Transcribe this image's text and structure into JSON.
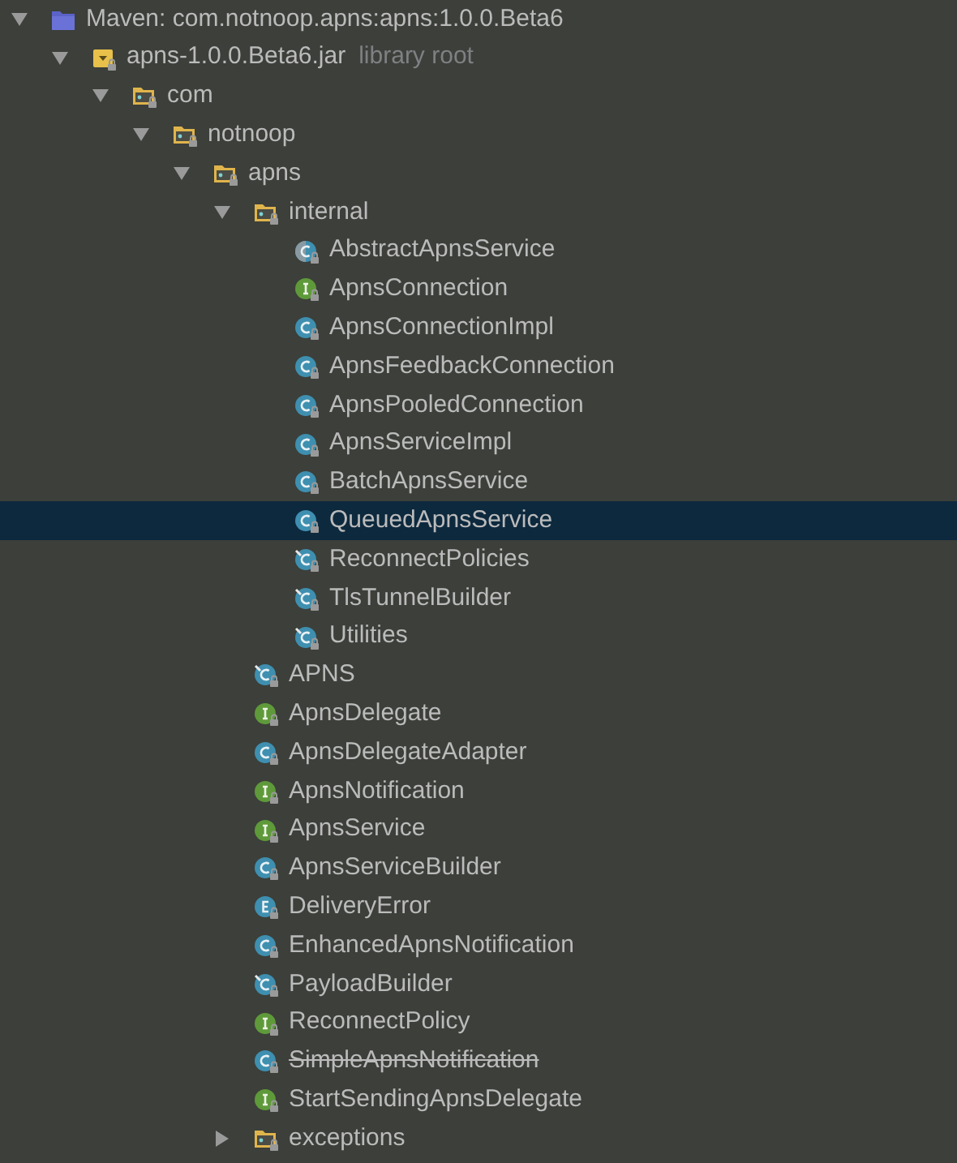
{
  "tree": [
    {
      "kind": "library",
      "label": "Maven: com.notnoop.apns:apns:1.0.0.Beta6",
      "expanded": true,
      "children": [
        {
          "kind": "jar",
          "label": "apns-1.0.0.Beta6.jar",
          "note": "library root",
          "expanded": true,
          "children": [
            {
              "kind": "package",
              "label": "com",
              "expanded": true,
              "children": [
                {
                  "kind": "package",
                  "label": "notnoop",
                  "expanded": true,
                  "children": [
                    {
                      "kind": "package",
                      "label": "apns",
                      "expanded": true,
                      "children": [
                        {
                          "kind": "package",
                          "label": "internal",
                          "expanded": true,
                          "children": [
                            {
                              "kind": "abstract",
                              "label": "AbstractApnsService",
                              "selected": false
                            },
                            {
                              "kind": "interface",
                              "label": "ApnsConnection",
                              "selected": false
                            },
                            {
                              "kind": "class",
                              "label": "ApnsConnectionImpl",
                              "selected": false
                            },
                            {
                              "kind": "class",
                              "label": "ApnsFeedbackConnection",
                              "selected": false
                            },
                            {
                              "kind": "class",
                              "label": "ApnsPooledConnection",
                              "selected": false
                            },
                            {
                              "kind": "class",
                              "label": "ApnsServiceImpl",
                              "selected": false
                            },
                            {
                              "kind": "class",
                              "label": "BatchApnsService",
                              "selected": false
                            },
                            {
                              "kind": "class",
                              "label": "QueuedApnsService",
                              "selected": true
                            },
                            {
                              "kind": "final",
                              "label": "ReconnectPolicies",
                              "selected": false
                            },
                            {
                              "kind": "final",
                              "label": "TlsTunnelBuilder",
                              "selected": false
                            },
                            {
                              "kind": "final",
                              "label": "Utilities",
                              "selected": false
                            }
                          ]
                        },
                        {
                          "kind": "final",
                          "label": "APNS",
                          "selected": false
                        },
                        {
                          "kind": "interface",
                          "label": "ApnsDelegate",
                          "selected": false
                        },
                        {
                          "kind": "class",
                          "label": "ApnsDelegateAdapter",
                          "selected": false
                        },
                        {
                          "kind": "interface",
                          "label": "ApnsNotification",
                          "selected": false
                        },
                        {
                          "kind": "interface",
                          "label": "ApnsService",
                          "selected": false
                        },
                        {
                          "kind": "class",
                          "label": "ApnsServiceBuilder",
                          "selected": false
                        },
                        {
                          "kind": "enum",
                          "label": "DeliveryError",
                          "selected": false
                        },
                        {
                          "kind": "class",
                          "label": "EnhancedApnsNotification",
                          "selected": false
                        },
                        {
                          "kind": "final",
                          "label": "PayloadBuilder",
                          "selected": false
                        },
                        {
                          "kind": "interface",
                          "label": "ReconnectPolicy",
                          "selected": false
                        },
                        {
                          "kind": "class",
                          "label": "SimpleApnsNotification",
                          "selected": false,
                          "deprecated": true
                        },
                        {
                          "kind": "interface",
                          "label": "StartSendingApnsDelegate",
                          "selected": false
                        },
                        {
                          "kind": "package",
                          "label": "exceptions",
                          "expanded": false
                        }
                      ]
                    }
                  ]
                }
              ]
            }
          ]
        }
      ]
    }
  ]
}
